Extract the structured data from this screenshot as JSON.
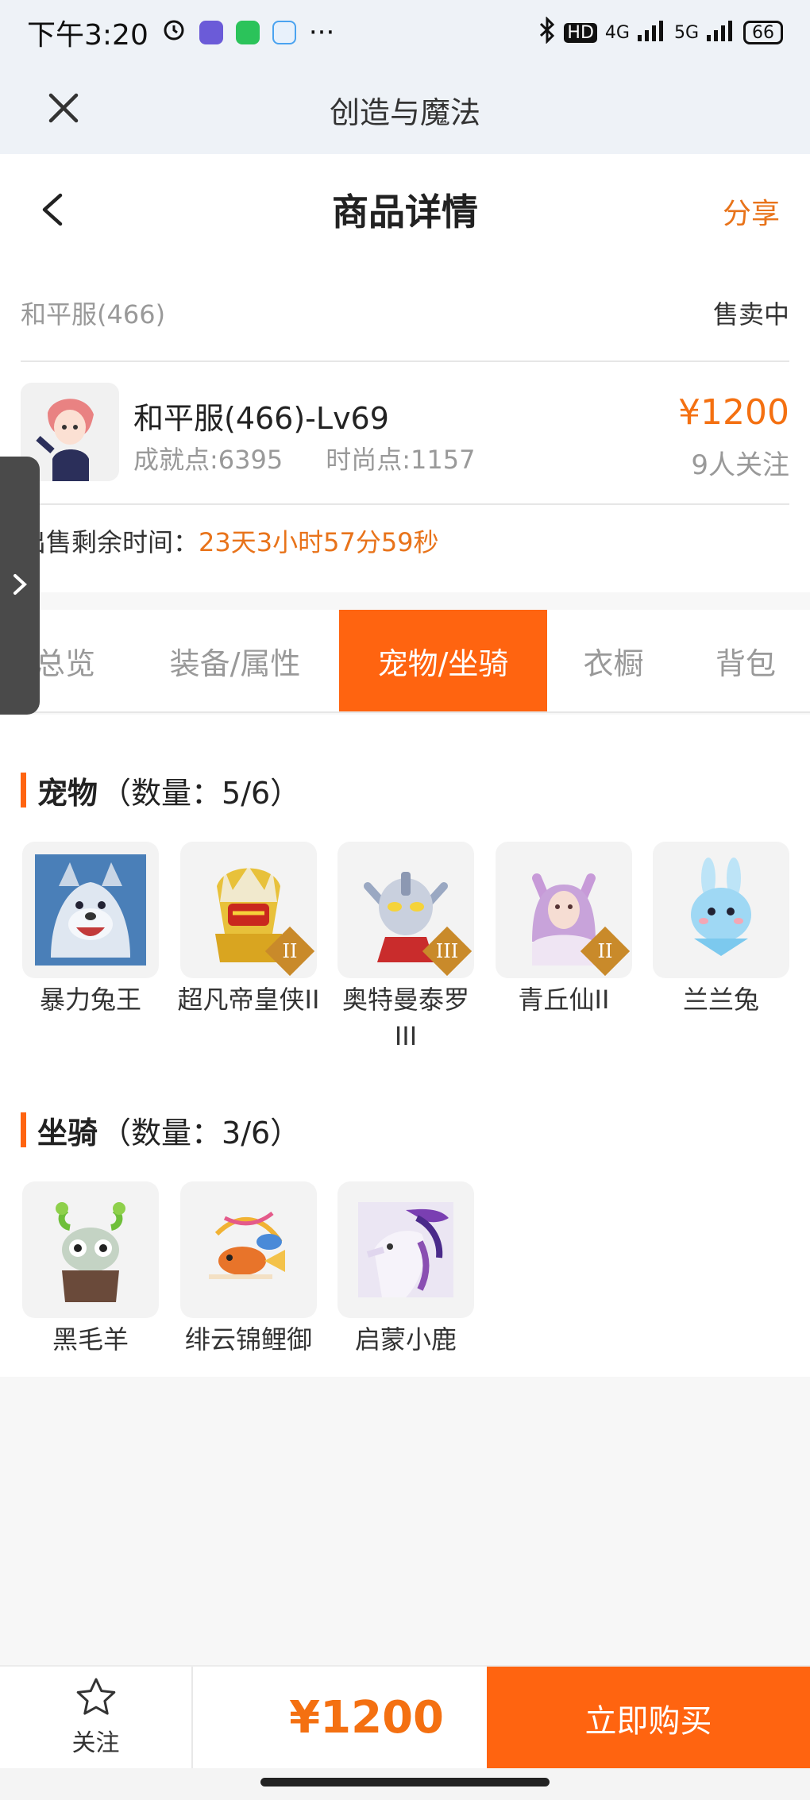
{
  "status_bar": {
    "time": "下午3:20",
    "more": "···",
    "network": "4G",
    "network2": "5G",
    "hd": "HD",
    "battery": "66"
  },
  "app_header": {
    "title": "创造与魔法"
  },
  "page_nav": {
    "title": "商品详情",
    "share_label": "分享"
  },
  "product": {
    "server": "和平服(466)",
    "sale_status": "售卖中",
    "name": "和平服(466)-Lv69",
    "achievement": "成就点:6395",
    "fashion": "时尚点:1157",
    "price": "¥1200",
    "followers": "9人关注",
    "remain_label": "出售剩余时间：",
    "remain_value": "23天3小时57分59秒"
  },
  "tabs": [
    {
      "label": "总览",
      "active": false
    },
    {
      "label": "装备/属性",
      "active": false
    },
    {
      "label": "宠物/坐骑",
      "active": true
    },
    {
      "label": "衣橱",
      "active": false
    },
    {
      "label": "背包",
      "active": false
    }
  ],
  "pets": {
    "title": "宠物",
    "count": "（数量：5/6）",
    "items": [
      {
        "name": "暴力兔王",
        "icon": "white-wolf-pet-icon",
        "tier": ""
      },
      {
        "name": "超凡帝皇侠II",
        "icon": "golden-armor-pet-icon",
        "tier": "II"
      },
      {
        "name": "奥特曼泰罗III",
        "icon": "ultraman-pet-icon",
        "tier": "III"
      },
      {
        "name": "青丘仙II",
        "icon": "fox-fairy-pet-icon",
        "tier": "II"
      },
      {
        "name": "兰兰兔",
        "icon": "blue-rabbit-pet-icon",
        "tier": ""
      }
    ]
  },
  "mounts": {
    "title": "坐骑",
    "count": "（数量：3/6）",
    "items": [
      {
        "name": "黑毛羊",
        "icon": "black-sheep-mount-icon"
      },
      {
        "name": "绯云锦鲤御",
        "icon": "koi-mount-icon"
      },
      {
        "name": "启蒙小鹿",
        "icon": "deer-mount-icon"
      }
    ]
  },
  "bottom_bar": {
    "follow_label": "关注",
    "price": "¥1200",
    "buy_label": "立即购买"
  },
  "colors": {
    "accent": "#ff6410",
    "price": "#f47011",
    "header_bg": "#eef2f7"
  }
}
